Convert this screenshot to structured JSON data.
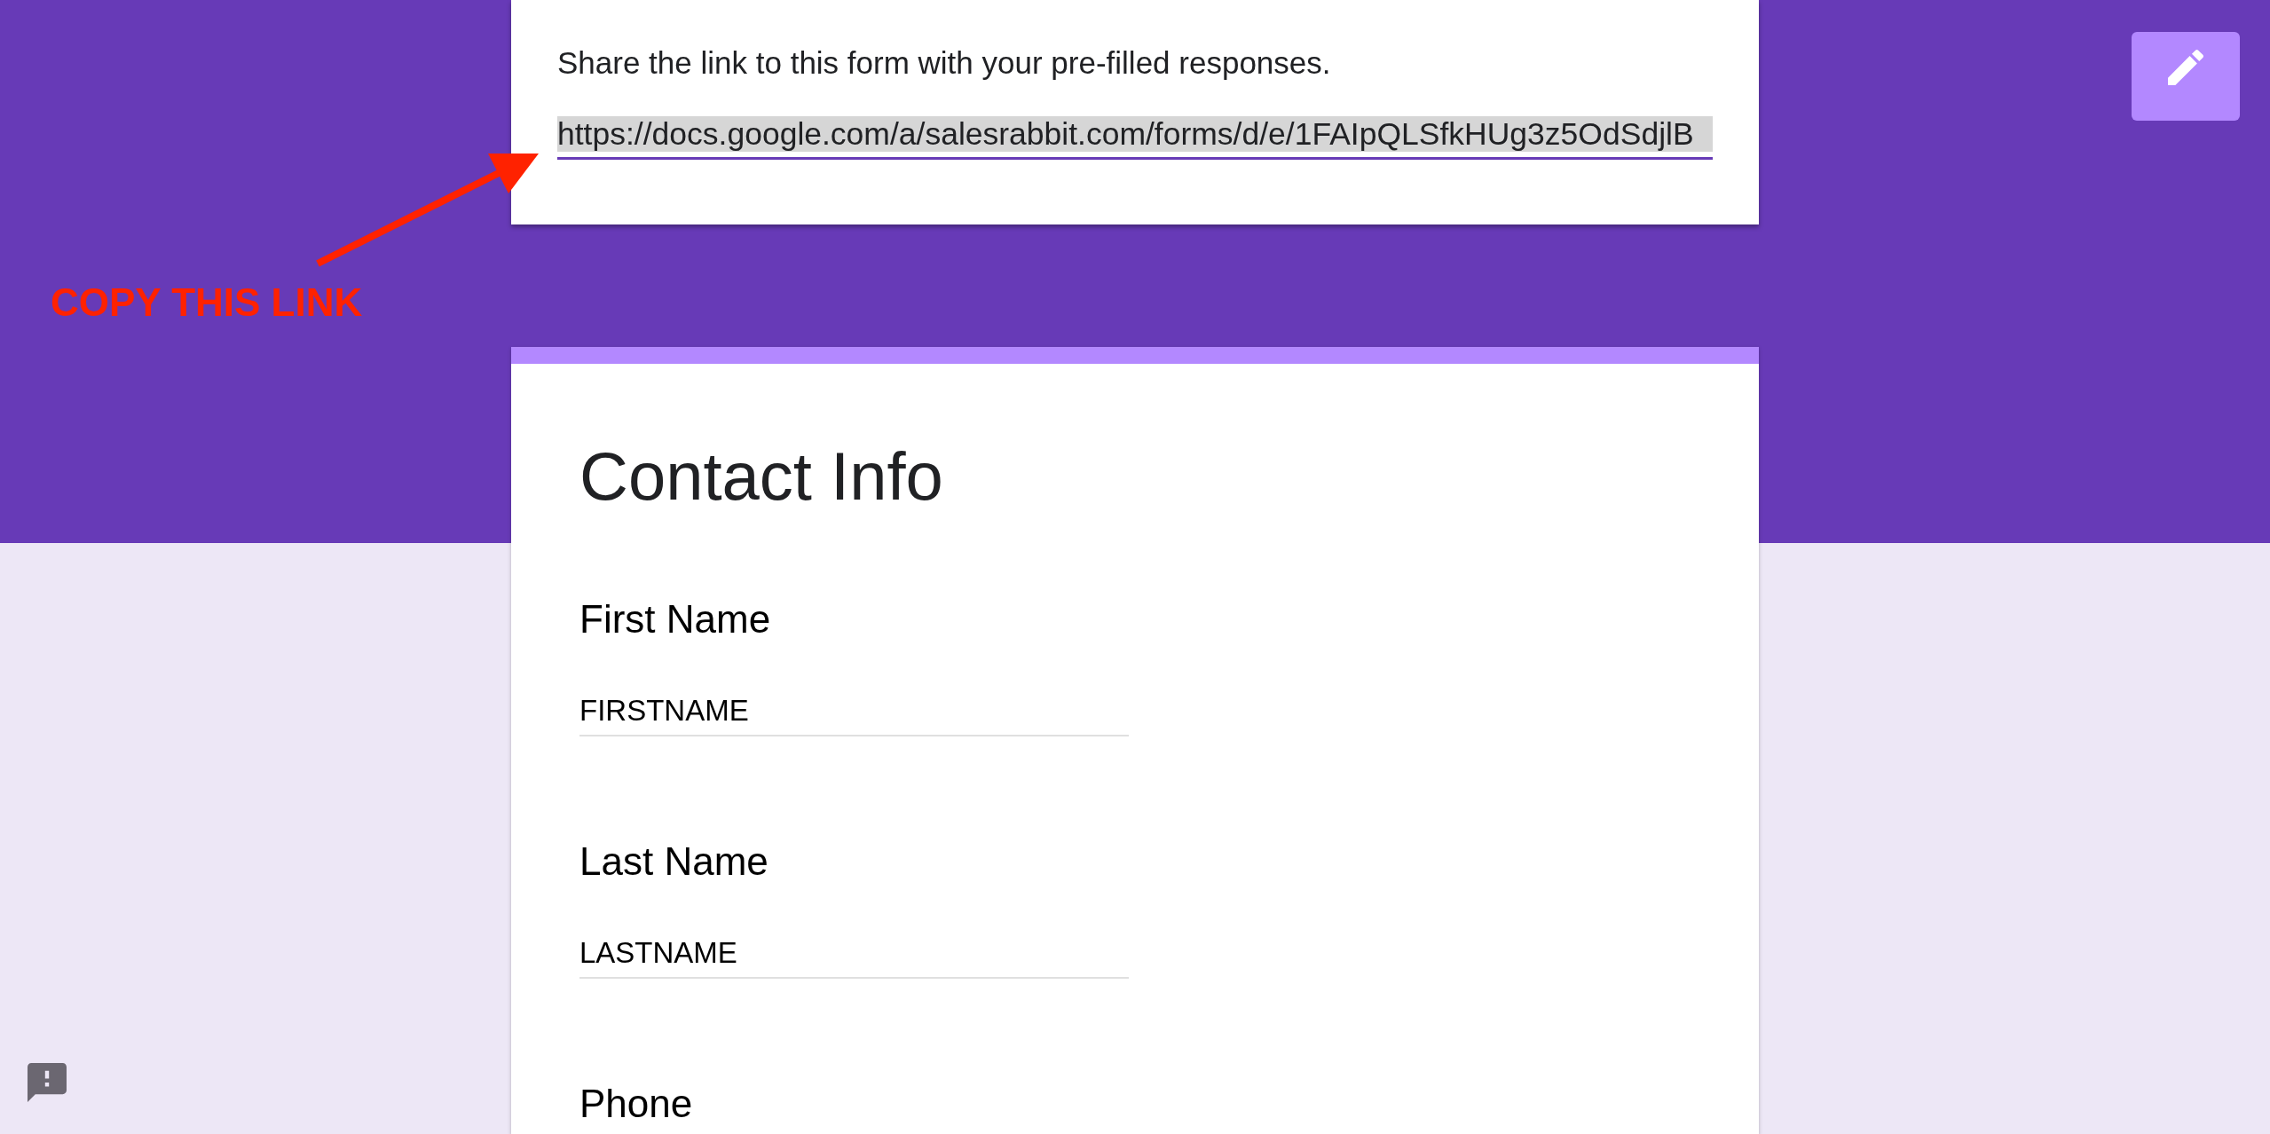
{
  "share_card": {
    "instruction": "Share the link to this form with your pre-filled responses.",
    "link_field": {
      "value": "https://docs.google.com/a/salesrabbit.com/forms/d/e/1FAIpQLSfkHUg3z5OdSdjlB",
      "text_selected": true,
      "focused": true
    }
  },
  "annotation": {
    "label": "COPY THIS LINK"
  },
  "form": {
    "section_title": "Contact Info",
    "questions": [
      {
        "label": "First Name",
        "value": "FIRSTNAME"
      },
      {
        "label": "Last Name",
        "value": "LASTNAME"
      },
      {
        "label": "Phone"
      }
    ]
  }
}
